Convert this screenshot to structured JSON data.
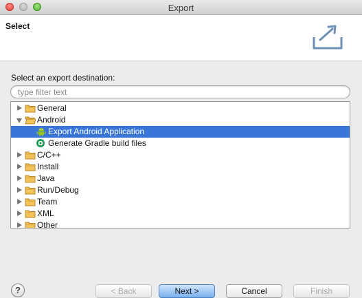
{
  "window": {
    "title": "Export"
  },
  "banner": {
    "title": "Select",
    "icon": "export-icon"
  },
  "prompt": "Select an export destination:",
  "filter": {
    "value": "",
    "placeholder": "type filter text"
  },
  "tree": [
    {
      "label": "General",
      "expanded": false,
      "icon": "folder-icon"
    },
    {
      "label": "Android",
      "expanded": true,
      "icon": "folder-icon"
    },
    {
      "label": "Export Android Application",
      "icon": "android-icon",
      "selected": true
    },
    {
      "label": "Generate Gradle build files",
      "icon": "gradle-icon"
    },
    {
      "label": "C/C++",
      "expanded": false,
      "icon": "folder-icon"
    },
    {
      "label": "Install",
      "expanded": false,
      "icon": "folder-icon"
    },
    {
      "label": "Java",
      "expanded": false,
      "icon": "folder-icon"
    },
    {
      "label": "Run/Debug",
      "expanded": false,
      "icon": "folder-icon"
    },
    {
      "label": "Team",
      "expanded": false,
      "icon": "folder-icon"
    },
    {
      "label": "XML",
      "expanded": false,
      "icon": "folder-icon"
    },
    {
      "label": "Other",
      "expanded": false,
      "icon": "folder-icon"
    }
  ],
  "buttons": {
    "help": "?",
    "back": "< Back",
    "next": "Next >",
    "cancel": "Cancel",
    "finish": "Finish"
  },
  "colors": {
    "selection": "#3875d7",
    "primary_button": "#79b1ef"
  }
}
